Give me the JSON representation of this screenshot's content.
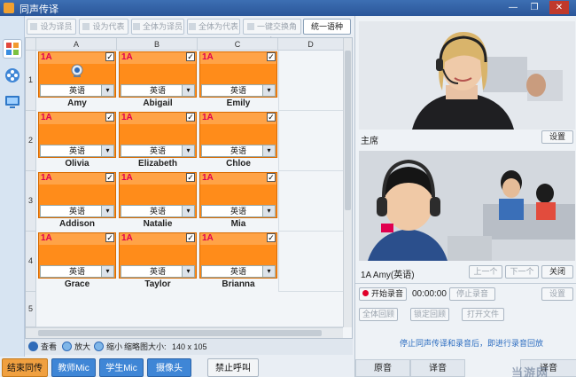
{
  "window": {
    "title": "同声传译"
  },
  "toolbar": {
    "buttons": [
      {
        "label": "设为译员",
        "active": false
      },
      {
        "label": "设为代表",
        "active": false
      },
      {
        "label": "全体为译员",
        "active": false
      },
      {
        "label": "全体为代表",
        "active": false
      },
      {
        "label": "一键交换角色",
        "active": false
      },
      {
        "label": "统一语种",
        "active": true
      }
    ]
  },
  "grid": {
    "columns": [
      "A",
      "B",
      "C",
      "D"
    ],
    "rows": [
      "1",
      "2",
      "3",
      "4",
      "5"
    ],
    "seats": [
      {
        "class": "1A",
        "name": "Amy",
        "lang": "英语",
        "checked": "✓",
        "webcam": true
      },
      {
        "class": "1A",
        "name": "Abigail",
        "lang": "英语",
        "checked": "✓"
      },
      {
        "class": "1A",
        "name": "Emily",
        "lang": "英语",
        "checked": "✓"
      },
      {
        "class": "1A",
        "name": "Olivia",
        "lang": "英语",
        "checked": "✓"
      },
      {
        "class": "1A",
        "name": "Elizabeth",
        "lang": "英语",
        "checked": "✓"
      },
      {
        "class": "1A",
        "name": "Chloe",
        "lang": "英语",
        "checked": "✓"
      },
      {
        "class": "1A",
        "name": "Addison",
        "lang": "英语",
        "checked": "✓"
      },
      {
        "class": "1A",
        "name": "Natalie",
        "lang": "英语",
        "checked": "✓"
      },
      {
        "class": "1A",
        "name": "Mia",
        "lang": "英语",
        "checked": "✓"
      },
      {
        "class": "1A",
        "name": "Grace",
        "lang": "英语",
        "checked": "✓"
      },
      {
        "class": "1A",
        "name": "Taylor",
        "lang": "英语",
        "checked": "✓"
      },
      {
        "class": "1A",
        "name": "Brianna",
        "lang": "英语",
        "checked": "✓"
      }
    ]
  },
  "viewbar": {
    "view": "查看",
    "zoom_in": "放大",
    "zoom_out": "缩小",
    "thumb_size_label": "缩略图大小:",
    "thumb_size_value": "140 x 105"
  },
  "bottom_buttons": {
    "end": "结束同传",
    "teacher_mic": "教师Mic",
    "student_mic": "学生Mic",
    "camera": "摄像头",
    "forbid_call": "禁止呼叫"
  },
  "right_panel": {
    "chair_label": "主席",
    "chair_settings": "设置",
    "student_label": "1A Amy(英语)",
    "prev": "上一个",
    "next": "下一个",
    "close": "关闭",
    "start_record": "开始录音",
    "timer": "00:00:00",
    "stop_record": "停止录音",
    "record_settings": "设置",
    "all_lock": "全体回顾",
    "fixed_lock": "锁定回顾",
    "open_file": "打开文件",
    "notice": "停止同声传译和录音后，即进行录音回放",
    "tabs": [
      "原音",
      "译音",
      "译音"
    ],
    "watermark": "当游网"
  },
  "colors": {
    "card_orange": "#ff8c1a",
    "end_button": "#f0a040",
    "blue_button": "#3f86d6",
    "accent_red": "#e0004f",
    "title_blue": "#2a5699"
  }
}
